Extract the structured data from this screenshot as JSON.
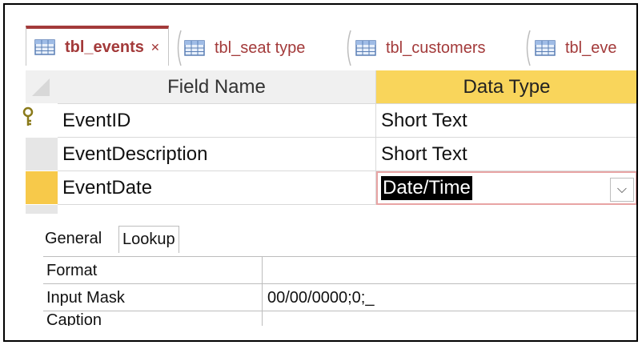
{
  "tabs": [
    {
      "label": "tbl_events",
      "active": true
    },
    {
      "label": "tbl_seat type",
      "active": false
    },
    {
      "label": "tbl_customers",
      "active": false
    },
    {
      "label": "tbl_eve",
      "active": false
    }
  ],
  "grid": {
    "headers": {
      "field_name": "Field Name",
      "data_type": "Data Type"
    },
    "rows": [
      {
        "field": "EventID",
        "type": "Short Text",
        "primary_key": true
      },
      {
        "field": "EventDescription",
        "type": "Short Text",
        "primary_key": false
      },
      {
        "field": "EventDate",
        "type": "Date/Time",
        "primary_key": false,
        "current": true
      }
    ]
  },
  "properties": {
    "tabs": [
      "General",
      "Lookup"
    ],
    "rows": [
      {
        "label": "Format",
        "value": ""
      },
      {
        "label": "Input Mask",
        "value": "00/00/0000;0;_"
      },
      {
        "label": "Caption",
        "value": ""
      }
    ]
  },
  "colors": {
    "tab_accent": "#a33a3a",
    "header_selected": "#f9d55b",
    "row_selector_current": "#f7c94a"
  }
}
